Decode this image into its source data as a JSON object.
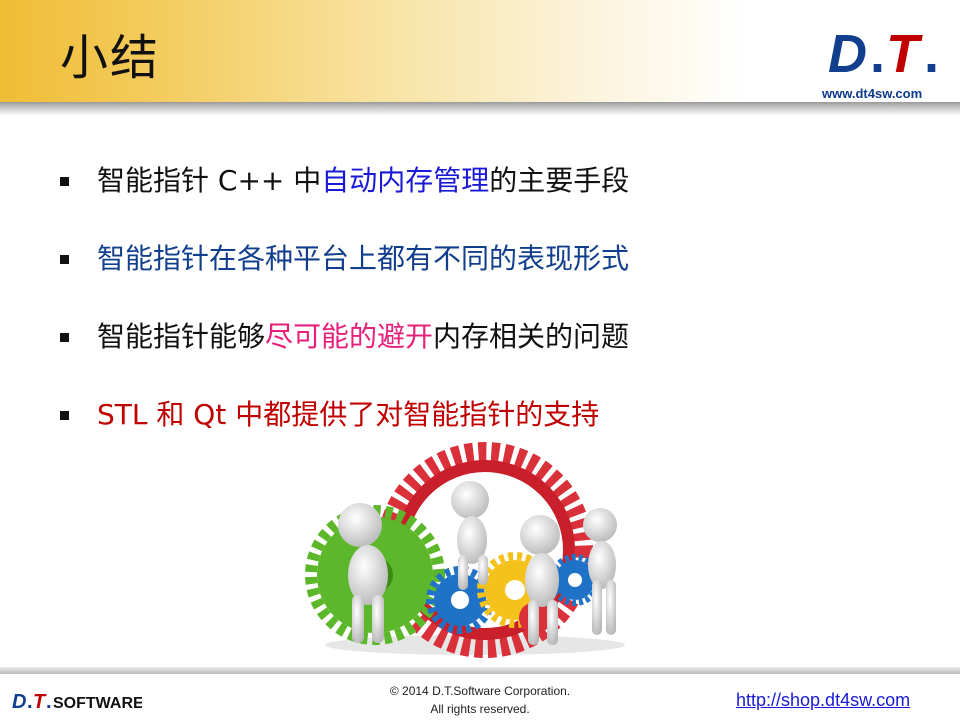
{
  "slide": {
    "title": "小结",
    "logo_text": "D.T.",
    "logo_url": "www.dt4sw.com"
  },
  "bullets": [
    {
      "segments": [
        {
          "text": "智能指针 C++ 中",
          "color": "black"
        },
        {
          "text": "自动内存管理",
          "color": "blue"
        },
        {
          "text": "的主要手段",
          "color": "black"
        }
      ]
    },
    {
      "segments": [
        {
          "text": "智能指针在各种平台上都有不同的表现形式",
          "color": "navy"
        }
      ]
    },
    {
      "segments": [
        {
          "text": "智能指针能够",
          "color": "black"
        },
        {
          "text": "尽可能的避开",
          "color": "magenta"
        },
        {
          "text": "内存相关的问题",
          "color": "black"
        }
      ]
    },
    {
      "segments": [
        {
          "text": "STL 和 Qt 中都提供了对智能指针的支持",
          "color": "red"
        }
      ]
    }
  ],
  "footer": {
    "brand_logo": "D.T.SOFTWARE",
    "copyright_line1": "© 2014 D.T.Software Corporation.",
    "copyright_line2": "All rights reserved.",
    "link": "http://shop.dt4sw.com"
  },
  "colors": {
    "header_gold": "#efbd35",
    "blue": "#1a1ad6",
    "navy": "#123f8d",
    "magenta": "#e8207a",
    "red": "#c00000",
    "black": "#111111"
  }
}
